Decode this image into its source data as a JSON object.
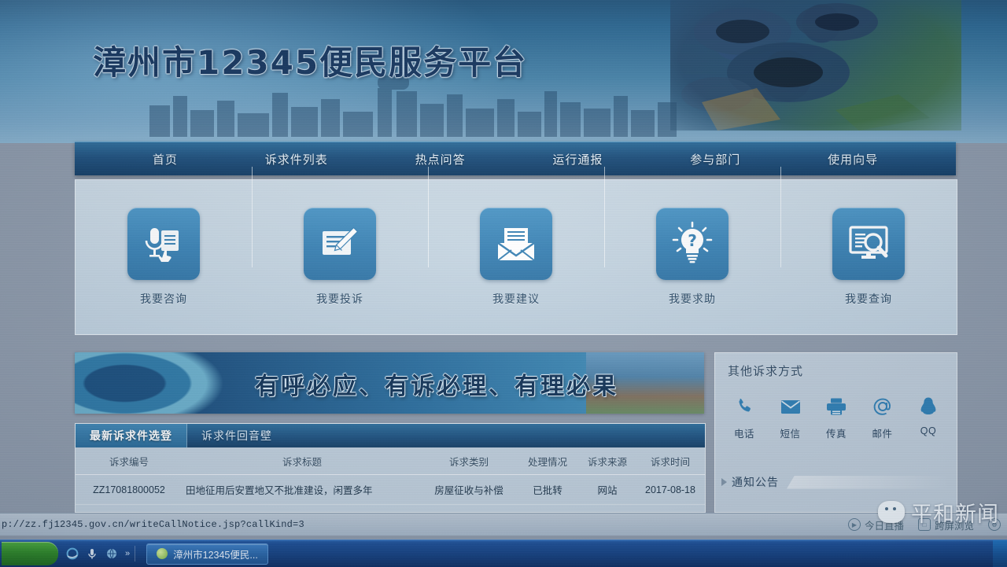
{
  "site": {
    "title": "漳州市12345便民服务平台",
    "header_image": "fujian-tulou-photo",
    "skyline_image": "city-skyline-silhouette"
  },
  "nav": {
    "items": [
      {
        "label": "首页",
        "name": "nav-home"
      },
      {
        "label": "诉求件列表",
        "name": "nav-appeal-list"
      },
      {
        "label": "热点问答",
        "name": "nav-hot-qa"
      },
      {
        "label": "运行通报",
        "name": "nav-operation-report"
      },
      {
        "label": "参与部门",
        "name": "nav-departments"
      },
      {
        "label": "使用向导",
        "name": "nav-user-guide"
      }
    ]
  },
  "services": [
    {
      "label": "我要咨询",
      "icon": "microphone-document-icon",
      "name": "service-consult"
    },
    {
      "label": "我要投诉",
      "icon": "pencil-paper-icon",
      "name": "service-complaint"
    },
    {
      "label": "我要建议",
      "icon": "envelope-icon",
      "name": "service-suggestion"
    },
    {
      "label": "我要求助",
      "icon": "lightbulb-question-icon",
      "name": "service-help"
    },
    {
      "label": "我要查询",
      "icon": "monitor-magnifier-icon",
      "name": "service-query"
    }
  ],
  "banner": {
    "slogan": "有呼必应、有诉必理、有理必果"
  },
  "list_panel": {
    "tabs": [
      {
        "label": "最新诉求件选登",
        "active": true
      },
      {
        "label": "诉求件回音壁",
        "active": false
      }
    ],
    "columns": [
      "诉求编号",
      "诉求标题",
      "诉求类别",
      "处理情况",
      "诉求来源",
      "诉求时间"
    ],
    "rows": [
      {
        "id": "ZZ17081800052",
        "title": "田地征用后安置地又不批准建设，闲置多年",
        "category": "房屋征收与补偿",
        "status": "已批转",
        "source": "网站",
        "date": "2017-08-18"
      }
    ]
  },
  "right_column": {
    "other_title": "其他诉求方式",
    "contacts": [
      {
        "label": "电话",
        "icon": "phone-icon"
      },
      {
        "label": "短信",
        "icon": "sms-envelope-icon"
      },
      {
        "label": "传真",
        "icon": "fax-printer-icon"
      },
      {
        "label": "邮件",
        "icon": "at-email-icon"
      },
      {
        "label": "QQ",
        "icon": "qq-penguin-icon"
      }
    ],
    "notice_title": "通知公告"
  },
  "statusbar": {
    "url": "p://zz.fj12345.gov.cn/writeCallNotice.jsp?callKind=3",
    "items": [
      {
        "label": "今日直播",
        "icon": "play-circle-icon"
      },
      {
        "label": "跨屏浏览",
        "icon": "phone-screen-icon"
      }
    ]
  },
  "watermark": {
    "text": "平和新闻",
    "icon": "wechat-bubble-icon"
  },
  "taskbar": {
    "start_label": "",
    "window_title": "漳州市12345便民...",
    "quicklaunch": [
      "ie-icon",
      "media-icon",
      "desktop-icon",
      "chevron-icon"
    ],
    "chevron": "»"
  },
  "colors": {
    "nav_blue": "#1d4f7c",
    "tile_blue": "#3a82b4",
    "page_bg": "#8e9aaa",
    "panel_bg": "#cddce9",
    "taskbar_blue": "#15407f",
    "contact_icon": "#2f7fb4"
  }
}
